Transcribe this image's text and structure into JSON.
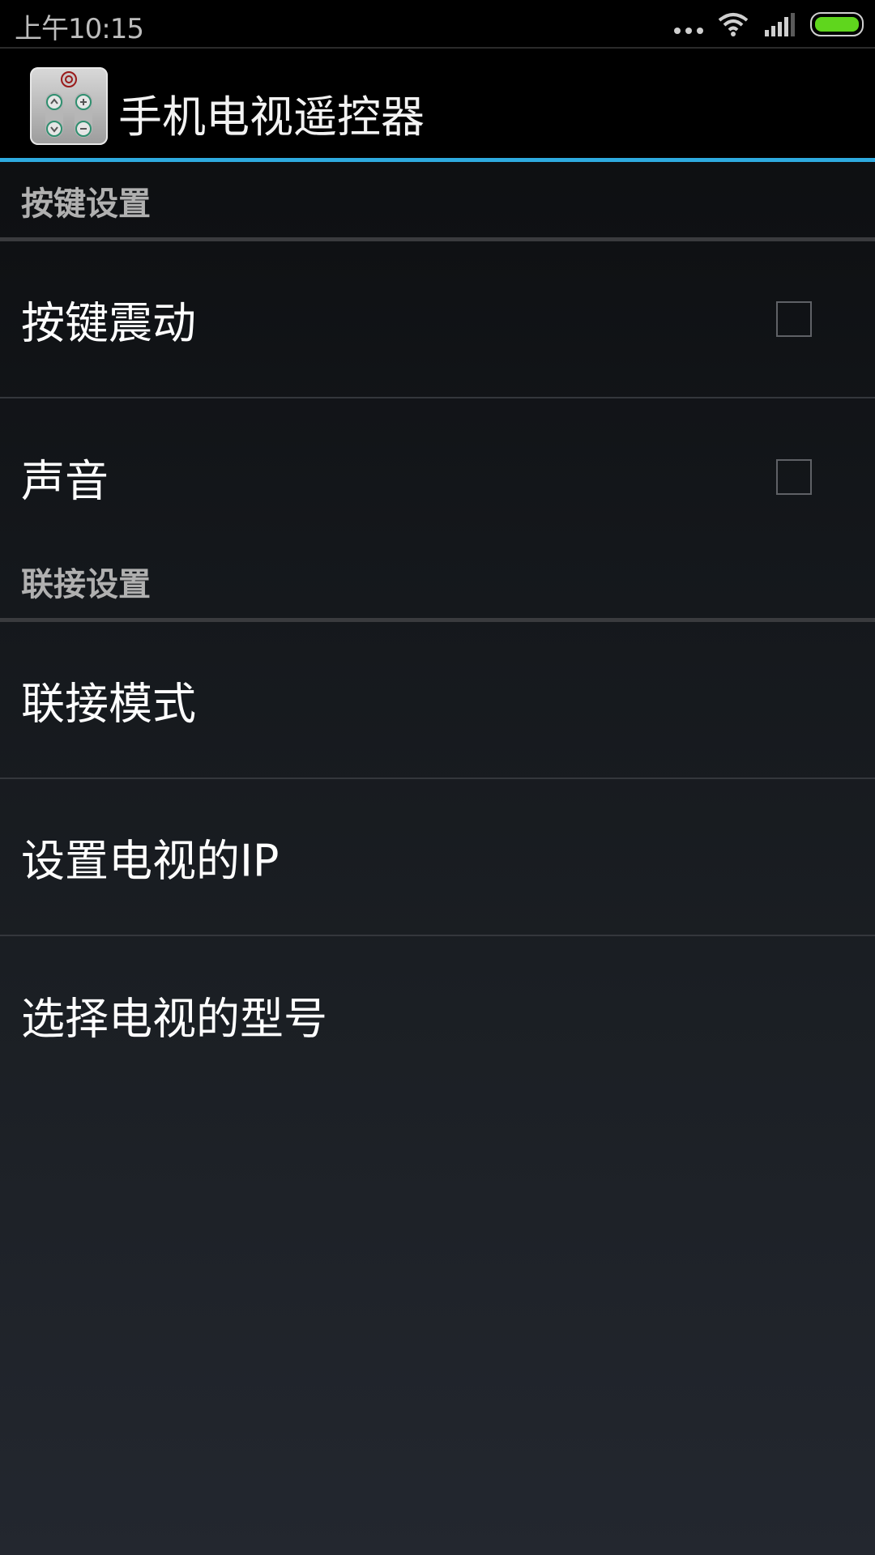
{
  "status_bar": {
    "time": "上午10:15",
    "icons": [
      "more-dots-icon",
      "wifi-icon",
      "signal-icon",
      "battery-icon"
    ],
    "battery_color": "#5fd61d"
  },
  "app_bar": {
    "title": "手机电视遥控器",
    "accent_color": "#2eaadf",
    "icon": "tv-remote-app-icon"
  },
  "sections": [
    {
      "header": "按键设置",
      "items": [
        {
          "label": "按键震动",
          "checked": false
        },
        {
          "label": "声音",
          "checked": false
        }
      ]
    },
    {
      "header": "联接设置",
      "items": [
        {
          "label": "联接模式"
        },
        {
          "label": "设置电视的IP"
        },
        {
          "label": "选择电视的型号"
        }
      ]
    }
  ]
}
